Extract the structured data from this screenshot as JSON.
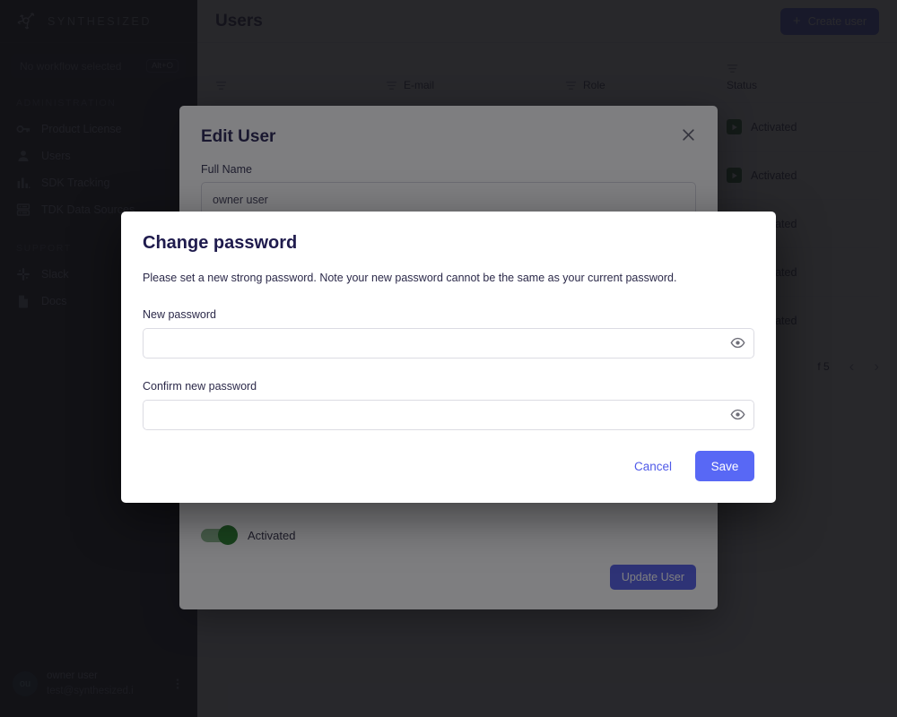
{
  "sidebar": {
    "logo_text": "SYNTHESIZED",
    "workflow": {
      "label": "No workflow selected",
      "shortcut": "Alt+O"
    },
    "sections": [
      {
        "title": "ADMINISTRATION",
        "items": [
          {
            "label": "Product License",
            "icon": "key-icon"
          },
          {
            "label": "Users",
            "icon": "user-icon"
          },
          {
            "label": "SDK Tracking",
            "icon": "bar-chart-icon"
          },
          {
            "label": "TDK Data Sources",
            "icon": "server-icon"
          }
        ]
      },
      {
        "title": "SUPPORT",
        "items": [
          {
            "label": "Slack",
            "icon": "slack-icon"
          },
          {
            "label": "Docs",
            "icon": "document-icon"
          }
        ]
      }
    ],
    "profile": {
      "initials": "ou",
      "name": "owner user",
      "email": "test@synthesized.i",
      "menu_icon": "kebab-menu-icon"
    }
  },
  "header": {
    "title": "Users",
    "create_button": "Create user",
    "create_icon": "plus-icon"
  },
  "table": {
    "columns": [
      "",
      "E-mail",
      "Role",
      "Status"
    ],
    "filter_icon": "filter-icon",
    "rows": [
      {
        "email": "",
        "role": "",
        "status": "Activated"
      },
      {
        "email": "",
        "role": "",
        "status": "Activated"
      },
      {
        "email": "",
        "role": "",
        "status": "Activated"
      },
      {
        "email": "",
        "role": "",
        "status": "Activated"
      },
      {
        "email": "",
        "role": "",
        "status": "Activated"
      }
    ],
    "status_icon": "play-icon",
    "pagination": {
      "summary": "f 5",
      "prev_icon": "chevron-left-icon",
      "next_icon": "chevron-right-icon"
    }
  },
  "edit_user_modal": {
    "title": "Edit User",
    "close_icon": "close-icon",
    "full_name_label": "Full Name",
    "full_name_value": "owner user",
    "toggle_label": "Activated",
    "update_button": "Update User"
  },
  "change_password_modal": {
    "title": "Change password",
    "description": "Please set a new strong password. Note your new password cannot be the same as your current password.",
    "new_password_label": "New password",
    "new_password_value": "",
    "new_password_placeholder": "",
    "confirm_password_label": "Confirm new password",
    "confirm_password_value": "",
    "confirm_password_placeholder": "",
    "reveal_icon": "eye-icon",
    "cancel_button": "Cancel",
    "save_button": "Save"
  },
  "colors": {
    "accent_blue": "#5868f5",
    "brand_indigo": "#4f5ae8",
    "sidebar_bg": "#0b0b14",
    "status_green": "#156218",
    "title_navy": "#1f1b4d"
  }
}
